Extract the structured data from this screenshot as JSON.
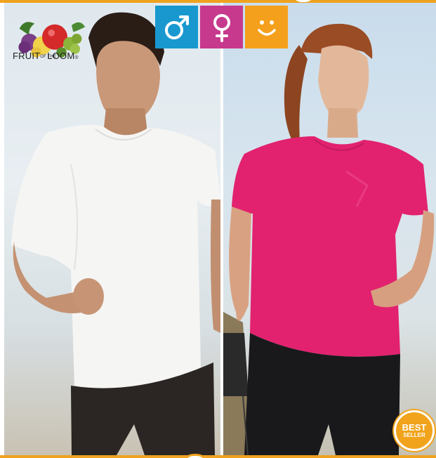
{
  "brand": {
    "name": "Fruit of the Loom",
    "logo_word_1": "FRUIT",
    "logo_word_small": "OF THE",
    "logo_word_2": "LOOM",
    "logo_mark": "®"
  },
  "gender_filter": {
    "tiles": [
      {
        "id": "male",
        "icon": "male-symbol-icon",
        "color": "#1898cf"
      },
      {
        "id": "female",
        "icon": "female-symbol-icon",
        "color": "#c6398c"
      },
      {
        "id": "unisex",
        "icon": "smiley-icon",
        "color": "#f4a01c"
      }
    ]
  },
  "photos": {
    "left": {
      "subject": "man-running-white-tshirt",
      "shirt_color": "#f4f4f4",
      "shorts_color": "#2a2522"
    },
    "right": {
      "subject": "woman-pink-tshirt",
      "shirt_color": "#e0206e",
      "leggings_color": "#1a1a1c"
    }
  },
  "badge": {
    "line1": "BEST",
    "line2": "SELLER",
    "color": "#f1a31b"
  },
  "accent_color": "#f0a21e"
}
